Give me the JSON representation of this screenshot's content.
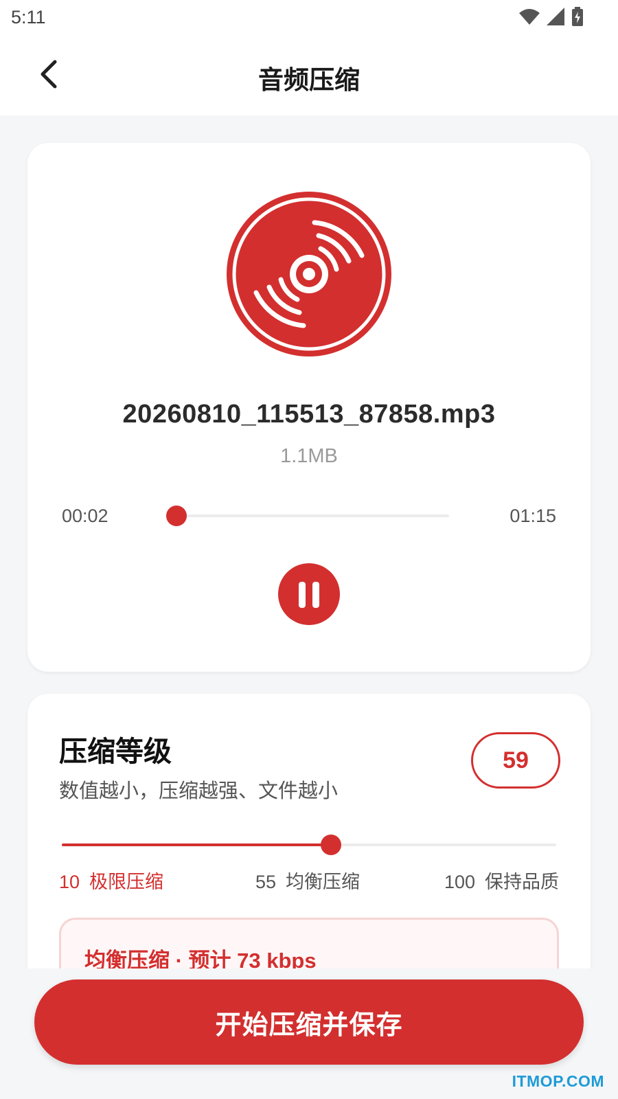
{
  "status_bar": {
    "time": "5:11",
    "icons": [
      "wifi-icon",
      "cell-signal-icon",
      "battery-charging-icon"
    ]
  },
  "header": {
    "title": "音频压缩",
    "back_icon": "chevron-left-icon"
  },
  "player": {
    "icon": "music-disc-icon",
    "file_name": "20260810_115513_87858.mp3",
    "file_size": "1.1MB",
    "current_time": "00:02",
    "total_time": "01:15",
    "progress": 0.027,
    "play_state_icon": "pause-icon"
  },
  "compression": {
    "title": "压缩等级",
    "subtitle": "数值越小，压缩越强、文件越小",
    "value": "59",
    "slider_min": 10,
    "slider_max": 100,
    "slider_value": 59,
    "scale": [
      {
        "num": "10",
        "label": "极限压缩"
      },
      {
        "num": "55",
        "label": "均衡压缩"
      },
      {
        "num": "100",
        "label": "保持品质"
      }
    ],
    "info": "均衡压缩 · 预计 73 kbps"
  },
  "actions": {
    "primary_label": "开始压缩并保存"
  },
  "watermark": "ITMOP.COM",
  "colors": {
    "accent": "#d32f2f",
    "background": "#f5f6f8",
    "card": "#ffffff",
    "info_bg": "#fff7f7",
    "watermark": "#1e9bd7"
  }
}
